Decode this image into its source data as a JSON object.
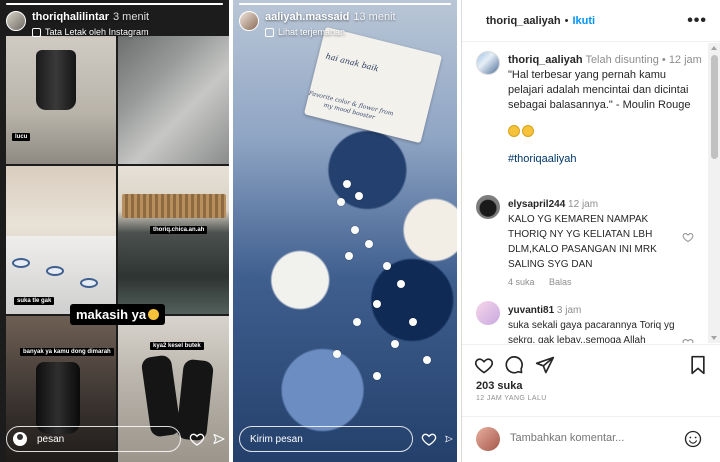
{
  "story_left": {
    "username": "thoriqhalilintar",
    "time": "3 menit",
    "subtitle": "Tata Letak oleh Instagram",
    "progress": 1.0,
    "captions": {
      "tile1": "lucu",
      "tile4": "thoriq.chica.an.ah",
      "tile3": "suka tle gak",
      "tile5": "banyak ya kamu dong dimarah",
      "tile6": "kya2 kesel butek"
    },
    "big_caption": "makasih ya",
    "reply_placeholder": "pesan"
  },
  "story_right": {
    "username": "aaliyah.massaid",
    "time": "13 menit",
    "subtitle": "Lihat terjemahan",
    "progress": 1.0,
    "card_line1": "hai anak baik",
    "card_line2": "Favorite color & flower from my mood booster",
    "reply_placeholder": "Kirim pesan"
  },
  "post": {
    "header": {
      "username": "thoriq_aaliyah",
      "separator": "•",
      "follow_label": "Ikuti",
      "more_label": "•••"
    },
    "caption": {
      "username": "thoriq_aaliyah",
      "edited": "Telah disunting",
      "dot": "•",
      "time": "12 jam",
      "text": "\"Hal terbesar yang pernah kamu pelajari adalah mencintai dan dicintai sebagai balasannya.\" - Moulin Rouge",
      "hashtag": "#thoriqaaliyah"
    },
    "comments": [
      {
        "username": "elysapril244",
        "time": "12 jam",
        "text": "KALO YG KEMAREN NAMPAK THORIQ NY YG KELIATAN LBH DLM,KALO PASANGAN INI MRK SALING SYG DAN",
        "likes": "4 suka",
        "reply_label": "Balas"
      },
      {
        "username": "yuvanti81",
        "time": "3 jam",
        "text": "suka sekali gaya pacarannya Toriq yg sekrg. gak lebay..semoga Allah"
      }
    ],
    "likes": "203 suka",
    "ago": "12 JAM YANG LALU",
    "add_comment_placeholder": "Tambahkan komentar..."
  }
}
